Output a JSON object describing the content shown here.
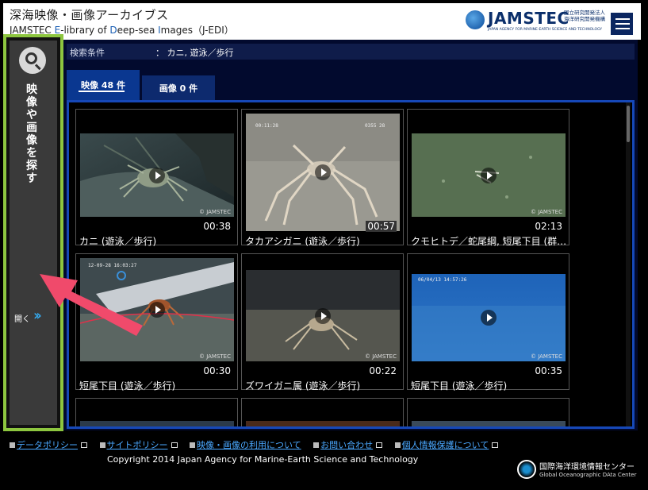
{
  "header": {
    "title": "深海映像・画像アーカイブス",
    "subtitle_parts": [
      "JAMSTEC ",
      "E",
      "-library of ",
      "D",
      "eep-sea ",
      "I",
      "mages（J-EDI）"
    ],
    "logo": {
      "name": "JAMSTEC",
      "jp_line1": "国立研究開発法人",
      "jp_line2": "海洋研究開発機構",
      "en": "JAPAN AGENCY FOR MARINE-EARTH SCIENCE AND TECHNOLOGY"
    },
    "menu_icon": "hamburger-icon"
  },
  "search_condition": {
    "label": "検索条件",
    "value": "：  カニ, 遊泳／歩行"
  },
  "tabs": [
    {
      "label": "映像 48 件",
      "active": true
    },
    {
      "label": "画像 0 件",
      "active": false
    }
  ],
  "videos": [
    {
      "caption": "カニ (遊泳／歩行)",
      "duration": "00:38",
      "watermark": "© JAMSTEC"
    },
    {
      "caption": "タカアシガニ (遊泳／歩行)",
      "duration": "00:57",
      "overlay_time": "00:11:28",
      "overlay_code": "0355  28"
    },
    {
      "caption": "クモヒトデ／蛇尾綱, 短尾下目 (群集,…",
      "duration": "02:13",
      "watermark": "© JAMSTEC"
    },
    {
      "caption": "短尾下目 (遊泳／歩行)",
      "duration": "00:30",
      "watermark": "© JAMSTEC",
      "overlay_date": "12-09-28 16:03:27"
    },
    {
      "caption": "ズワイガニ属 (遊泳／歩行)",
      "duration": "00:22",
      "watermark": "© JAMSTEC"
    },
    {
      "caption": "短尾下目 (遊泳／歩行)",
      "duration": "00:35",
      "watermark": "© JAMSTEC",
      "overlay_date": "06/04/13 14:57:26"
    }
  ],
  "sidebar": {
    "search_icon": "search-icon",
    "label": "映像や画像を探す",
    "open_label": "開く",
    "open_icon": "double-chevron-right-icon"
  },
  "footer": {
    "links": [
      {
        "label": "データポリシー",
        "external": true
      },
      {
        "label": "サイトポリシー",
        "external": true
      },
      {
        "label": "映像・画像の利用について",
        "external": false
      },
      {
        "label": "お問い合わせ",
        "external": true
      },
      {
        "label": "個人情報保護について",
        "external": true
      }
    ],
    "copyright": "Copyright 2014 Japan Agency for Marine-Earth Science and Technology",
    "goda_jp": "国際海洋環境情報センター",
    "goda_en": "Global Oceanographic DAta Center"
  },
  "colors": {
    "main_bg": "#020a2e",
    "tab_active": "#0a3790",
    "grid_border": "#1648b8",
    "sidebar_highlight": "#8dc63f",
    "arrow": "#f04a6b",
    "link": "#4aa8ff"
  }
}
